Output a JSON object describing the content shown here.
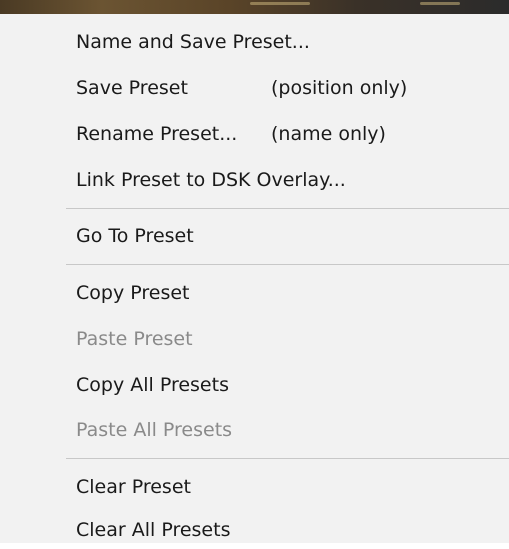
{
  "menu": {
    "items": [
      {
        "label": "Name and Save Preset...",
        "disabled": false
      },
      {
        "label": "Save Preset",
        "note": "(position only)",
        "disabled": false
      },
      {
        "label": "Rename Preset...",
        "note": "(name only)",
        "disabled": false
      },
      {
        "label": "Link Preset to DSK Overlay...",
        "disabled": false
      },
      {
        "label": "Go To Preset",
        "disabled": false
      },
      {
        "label": "Copy Preset",
        "disabled": false
      },
      {
        "label": "Paste Preset",
        "disabled": true
      },
      {
        "label": "Copy All Presets",
        "disabled": false
      },
      {
        "label": "Paste All Presets",
        "disabled": true
      },
      {
        "label": "Clear Preset",
        "disabled": false
      },
      {
        "label": "Clear All Presets",
        "disabled": false
      }
    ]
  }
}
